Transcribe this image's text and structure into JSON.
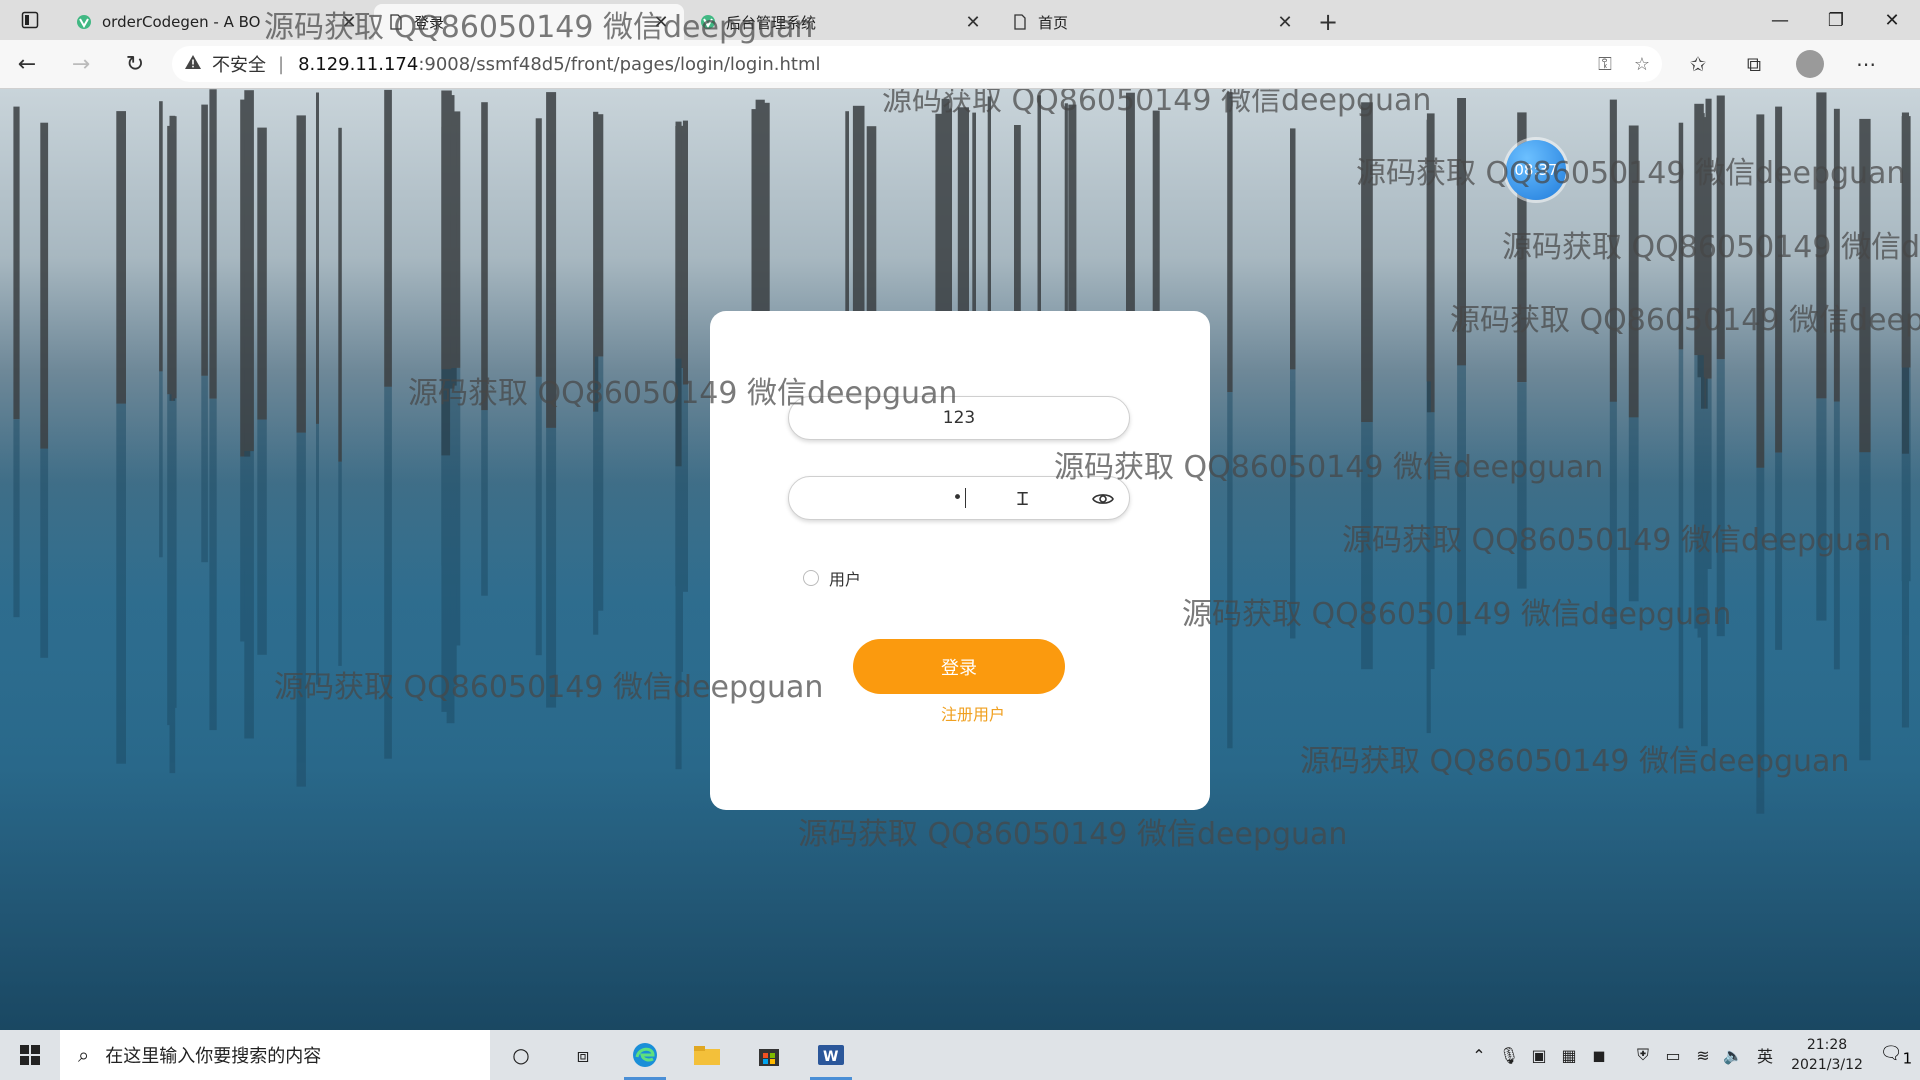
{
  "browser": {
    "tabs": [
      {
        "title": "orderCodegen - A BO",
        "favicon": "vue-icon",
        "active": false
      },
      {
        "title": "登录",
        "favicon": "page-icon",
        "active": true
      },
      {
        "title": "后台管理系统",
        "favicon": "vue-icon",
        "active": false
      },
      {
        "title": "首页",
        "favicon": "page-icon",
        "active": false
      }
    ],
    "new_tab": "+",
    "address": {
      "security_label": "不安全",
      "host": "8.129.11.174",
      "path": ":9008/ssmf48d5/front/pages/login/login.html"
    }
  },
  "page": {
    "clock_bubble": "08:37",
    "watermark_text": "源码获取 QQ86050149 微信deepguan",
    "login": {
      "username_value": "123",
      "password_value": "•",
      "role_label": "用户",
      "login_button": "登录",
      "register_link": "注册用户"
    }
  },
  "taskbar": {
    "search_placeholder": "在这里输入你要搜索的内容",
    "ime_label": "英",
    "time": "21:28",
    "date": "2021/3/12",
    "notification_count": "1"
  },
  "colors": {
    "accent_button": "#fb9a0e",
    "register_link": "#f0a020",
    "clock_bubble": "#1f7bdb"
  }
}
